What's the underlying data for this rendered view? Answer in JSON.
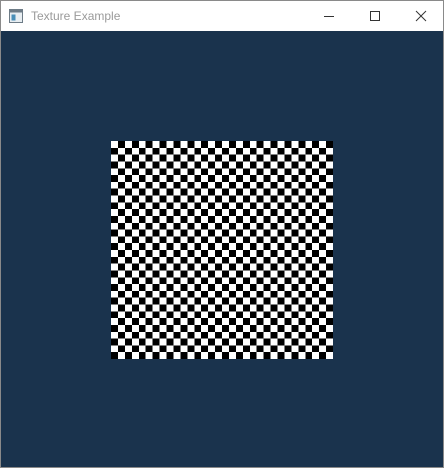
{
  "window": {
    "title": "Texture Example",
    "background_color": "#1a334d",
    "title_color": "#9a9a9a",
    "icons": {
      "app": "window-app-icon",
      "minimize": "minimize-icon",
      "maximize": "maximize-icon",
      "close": "close-icon"
    }
  },
  "texture": {
    "pattern": "checkerboard",
    "colors": [
      "#ffffff",
      "#000000"
    ],
    "columns": 32,
    "rows": 32
  }
}
